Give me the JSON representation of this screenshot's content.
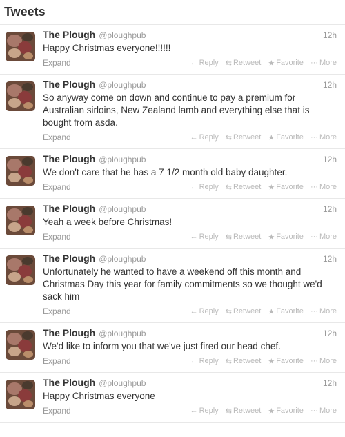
{
  "header": {
    "title": "Tweets"
  },
  "actions": {
    "reply": "Reply",
    "retweet": "Retweet",
    "favorite": "Favorite",
    "more": "More",
    "expand": "Expand"
  },
  "tweets": [
    {
      "name": "The Plough",
      "handle": "@ploughpub",
      "time": "12h",
      "text": "Happy Christmas everyone!!!!!!"
    },
    {
      "name": "The Plough",
      "handle": "@ploughpub",
      "time": "12h",
      "text": "So anyway come on down and continue to pay a premium for Australian sirloins, New Zealand lamb and everything else that is bought from asda."
    },
    {
      "name": "The Plough",
      "handle": "@ploughpub",
      "time": "12h",
      "text": "We don't care that he has a 7 1/2 month old baby daughter."
    },
    {
      "name": "The Plough",
      "handle": "@ploughpub",
      "time": "12h",
      "text": "Yeah a week before Christmas!"
    },
    {
      "name": "The Plough",
      "handle": "@ploughpub",
      "time": "12h",
      "text": "Unfortunately he wanted to have a weekend off this month and Christmas Day this year for family commitments so we thought we'd sack him"
    },
    {
      "name": "The Plough",
      "handle": "@ploughpub",
      "time": "12h",
      "text": "We'd like to inform you that we've just fired our head chef."
    },
    {
      "name": "The Plough",
      "handle": "@ploughpub",
      "time": "12h",
      "text": "Happy Christmas everyone"
    }
  ]
}
